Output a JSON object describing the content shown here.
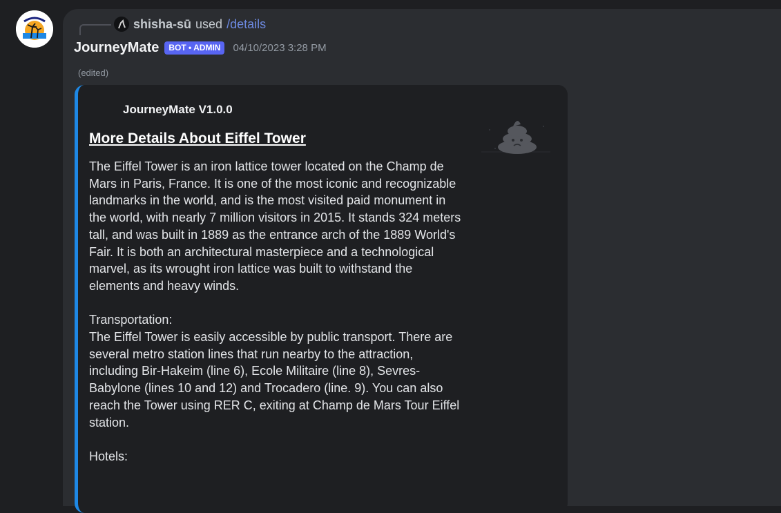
{
  "reply": {
    "username": "shisha-sū",
    "used_text": "used",
    "command": "/details"
  },
  "message": {
    "author": "JourneyMate",
    "badge": "BOT • ADMIN",
    "timestamp": "04/10/2023 3:28 PM",
    "edited_label": "(edited)"
  },
  "embed": {
    "accent_color": "#1e88e5",
    "author": "JourneyMate V1.0.0",
    "title": "More Details About Eiffel Tower",
    "thumbnail_icon": "poop-icon",
    "description": "The Eiffel Tower is an iron lattice tower located on the Champ de Mars in Paris, France. It is one of the most iconic and recognizable landmarks in the world, and is the most visited paid monument in the world, with nearly 7 million visitors in 2015. It stands 324 meters tall, and was built in 1889 as the entrance arch of the 1889 World's Fair. It is both an architectural masterpiece and a technological marvel, as its wrought iron lattice was built to withstand the elements and heavy winds.",
    "transport_heading": "Transportation:",
    "transport_text": "The Eiffel Tower is easily accessible by public transport. There are several metro station lines that run nearby to the attraction, including Bir-Hakeim (line 6), Ecole Militaire (line 8), Sevres-Babylone (lines 10 and 12) and Trocadero (line. 9). You can also reach the Tower using RER C, exiting at Champ de Mars Tour Eiffel station.",
    "hotels_heading": "Hotels:"
  }
}
